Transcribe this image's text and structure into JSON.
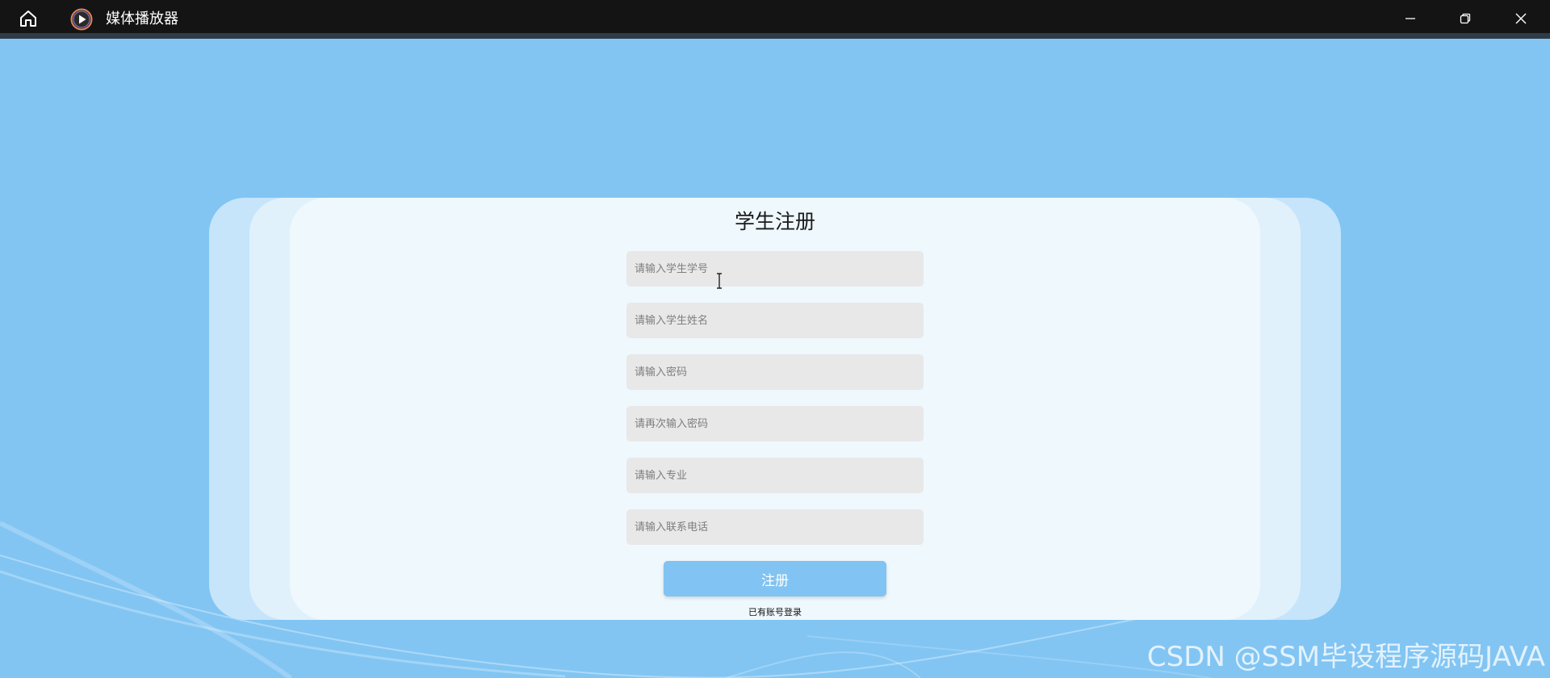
{
  "titlebar": {
    "app_title": "媒体播放器",
    "icons": {
      "home": "home-icon",
      "app": "play-circle-icon",
      "minimize": "minimize-icon",
      "maximize": "restore-icon",
      "close": "close-icon"
    },
    "colors": {
      "background": "#141414",
      "text": "#ffffff"
    }
  },
  "form": {
    "title": "学生注册",
    "fields": [
      {
        "name": "student-id",
        "placeholder": "请输入学生学号",
        "value": ""
      },
      {
        "name": "student-name",
        "placeholder": "请输入学生姓名",
        "value": ""
      },
      {
        "name": "password",
        "placeholder": "请输入密码",
        "value": ""
      },
      {
        "name": "confirm-password",
        "placeholder": "请再次输入密码",
        "value": ""
      },
      {
        "name": "major",
        "placeholder": "请输入专业",
        "value": ""
      },
      {
        "name": "phone",
        "placeholder": "请输入联系电话",
        "value": ""
      }
    ],
    "submit_label": "注册",
    "login_link": "已有账号登录"
  },
  "watermark": "CSDN @SSM毕设程序源码JAVA",
  "colors": {
    "page_background": "#82c5f3",
    "field_background": "#e8e8e8",
    "button_background": "#81c3f2"
  }
}
